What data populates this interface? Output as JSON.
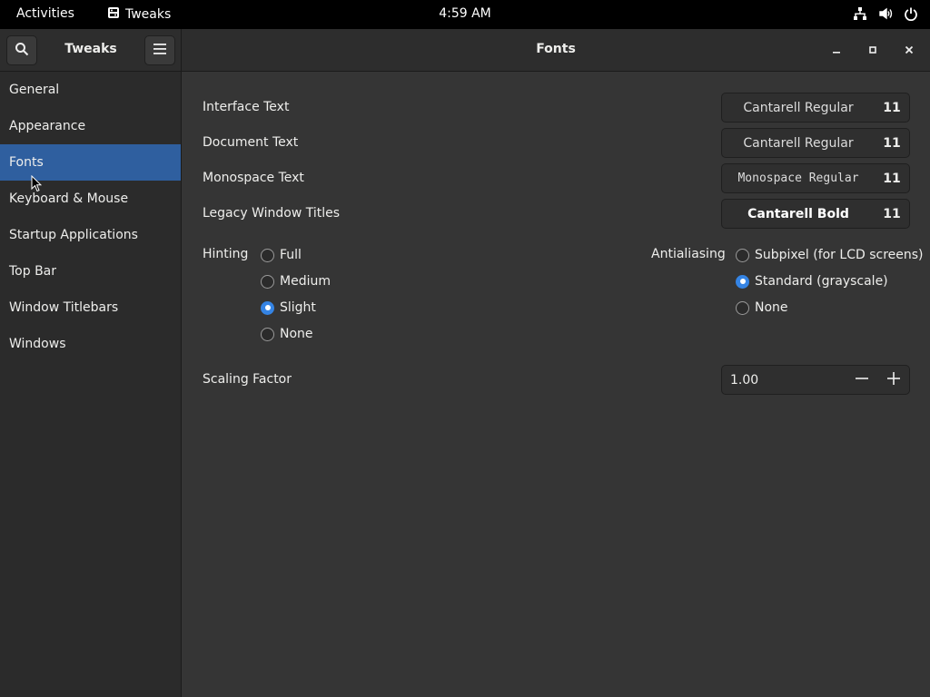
{
  "topbar": {
    "activities": "Activities",
    "app_name": "Tweaks",
    "clock": "4:59 AM",
    "icons": [
      "network-icon",
      "volume-icon",
      "power-icon"
    ]
  },
  "headerbar": {
    "left_title": "Tweaks",
    "main_title": "Fonts"
  },
  "sidebar": {
    "items": [
      {
        "label": "General",
        "active": false
      },
      {
        "label": "Appearance",
        "active": false
      },
      {
        "label": "Fonts",
        "active": true
      },
      {
        "label": "Keyboard & Mouse",
        "active": false
      },
      {
        "label": "Startup Applications",
        "active": false
      },
      {
        "label": "Top Bar",
        "active": false
      },
      {
        "label": "Window Titlebars",
        "active": false
      },
      {
        "label": "Windows",
        "active": false
      }
    ]
  },
  "fonts": {
    "interface": {
      "label": "Interface Text",
      "font": "Cantarell Regular",
      "size": "11"
    },
    "document": {
      "label": "Document Text",
      "font": "Cantarell Regular",
      "size": "11"
    },
    "monospace": {
      "label": "Monospace Text",
      "font": "Monospace Regular",
      "size": "11"
    },
    "legacy": {
      "label": "Legacy Window Titles",
      "font": "Cantarell Bold",
      "size": "11"
    }
  },
  "hinting": {
    "label": "Hinting",
    "options": [
      "Full",
      "Medium",
      "Slight",
      "None"
    ],
    "selected": "Slight"
  },
  "antialiasing": {
    "label": "Antialiasing",
    "options": [
      "Subpixel (for LCD screens)",
      "Standard (grayscale)",
      "None"
    ],
    "selected": "Standard (grayscale)"
  },
  "scaling": {
    "label": "Scaling Factor",
    "value": "1.00"
  },
  "colors": {
    "accent": "#3584e4",
    "sidebar_selected": "#2f5f9f"
  }
}
